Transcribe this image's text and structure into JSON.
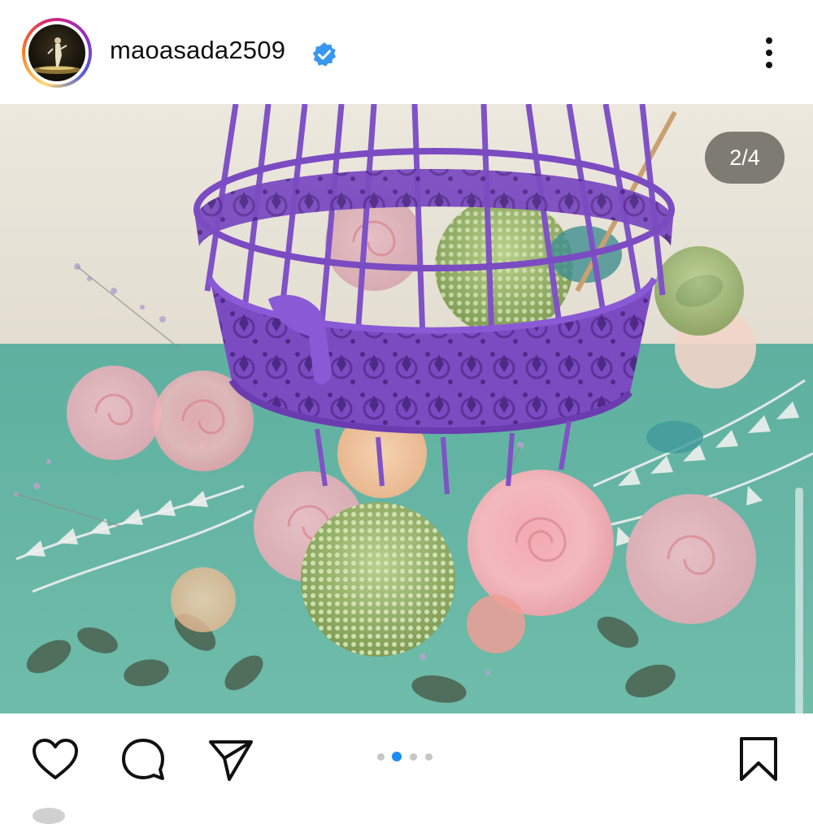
{
  "header": {
    "username": "maoasada2509",
    "verified": true,
    "avatar_icon": "profile-avatar",
    "more_icon": "more-vertical-icon"
  },
  "post": {
    "counter": "2/4",
    "current_slide": 2,
    "total_slides": 4,
    "image_description_icon": "photo-birdcage-flowers"
  },
  "actions": {
    "like_icon": "heart-icon",
    "comment_icon": "comment-icon",
    "share_icon": "send-icon",
    "save_icon": "bookmark-icon"
  },
  "colors": {
    "verified_badge": "#3897f0",
    "active_dot": "#1d8cf0",
    "inactive_dot": "#c7c7c7",
    "cage_purple": "#7b4bc2"
  }
}
